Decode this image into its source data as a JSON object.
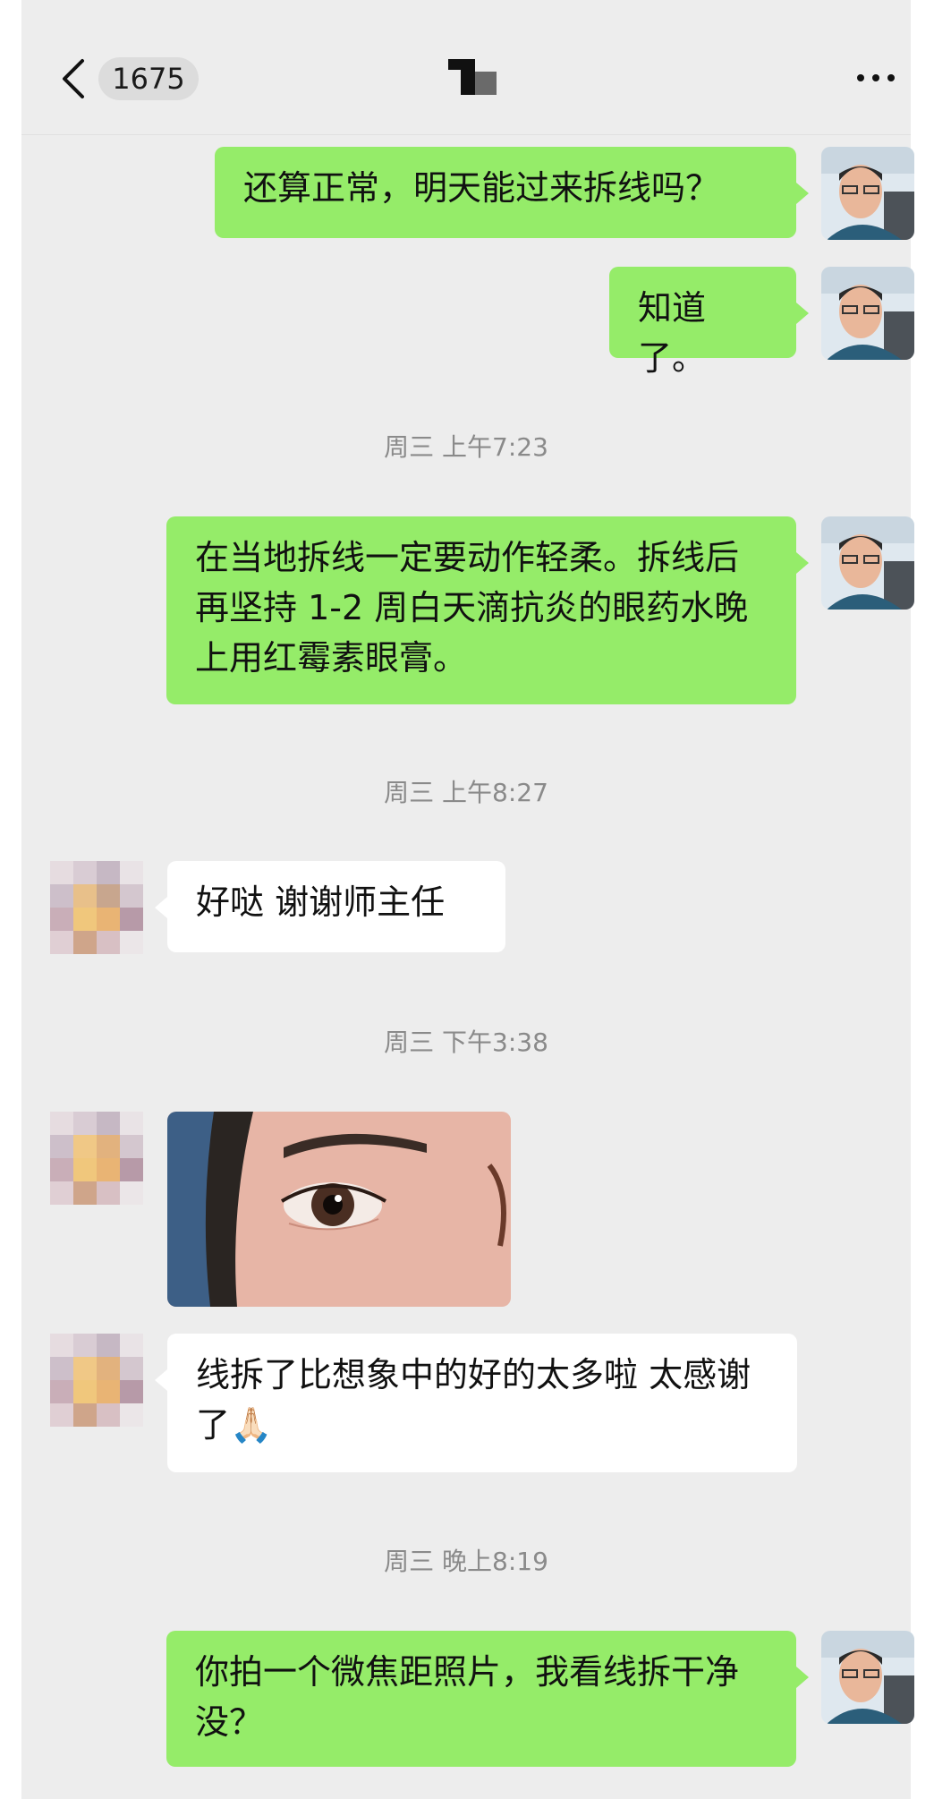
{
  "header": {
    "unread_count": "1675",
    "back_icon": "chevron-left-icon",
    "title_icon": "contact-logo-icon",
    "more_icon": "more-dots-icon"
  },
  "messages": [
    {
      "side": "out",
      "text": "还算正常，明天能过来拆线吗？"
    },
    {
      "side": "out",
      "text": "知道了。"
    },
    {
      "side": "time",
      "text": "周三 上午7:23"
    },
    {
      "side": "out",
      "text": "在当地拆线一定要动作轻柔。拆线后再坚持 1-2 周白天滴抗炎的眼药水晚上用红霉素眼膏。"
    },
    {
      "side": "time",
      "text": "周三 上午8:27"
    },
    {
      "side": "in",
      "text": "好哒 谢谢师主任"
    },
    {
      "side": "time",
      "text": "周三 下午3:38"
    },
    {
      "side": "in",
      "type": "image",
      "alt": "eye-photo"
    },
    {
      "side": "in",
      "text": "线拆了比想象中的好的太多啦  太感谢了🙏🏻"
    },
    {
      "side": "time",
      "text": "周三 晚上8:19"
    },
    {
      "side": "out",
      "text": "你拍一个微焦距照片，我看线拆干净没？"
    }
  ],
  "colors": {
    "background": "#ededed",
    "outgoing_bubble": "#95ec69",
    "incoming_bubble": "#ffffff",
    "timestamp": "#8a8a8a"
  }
}
